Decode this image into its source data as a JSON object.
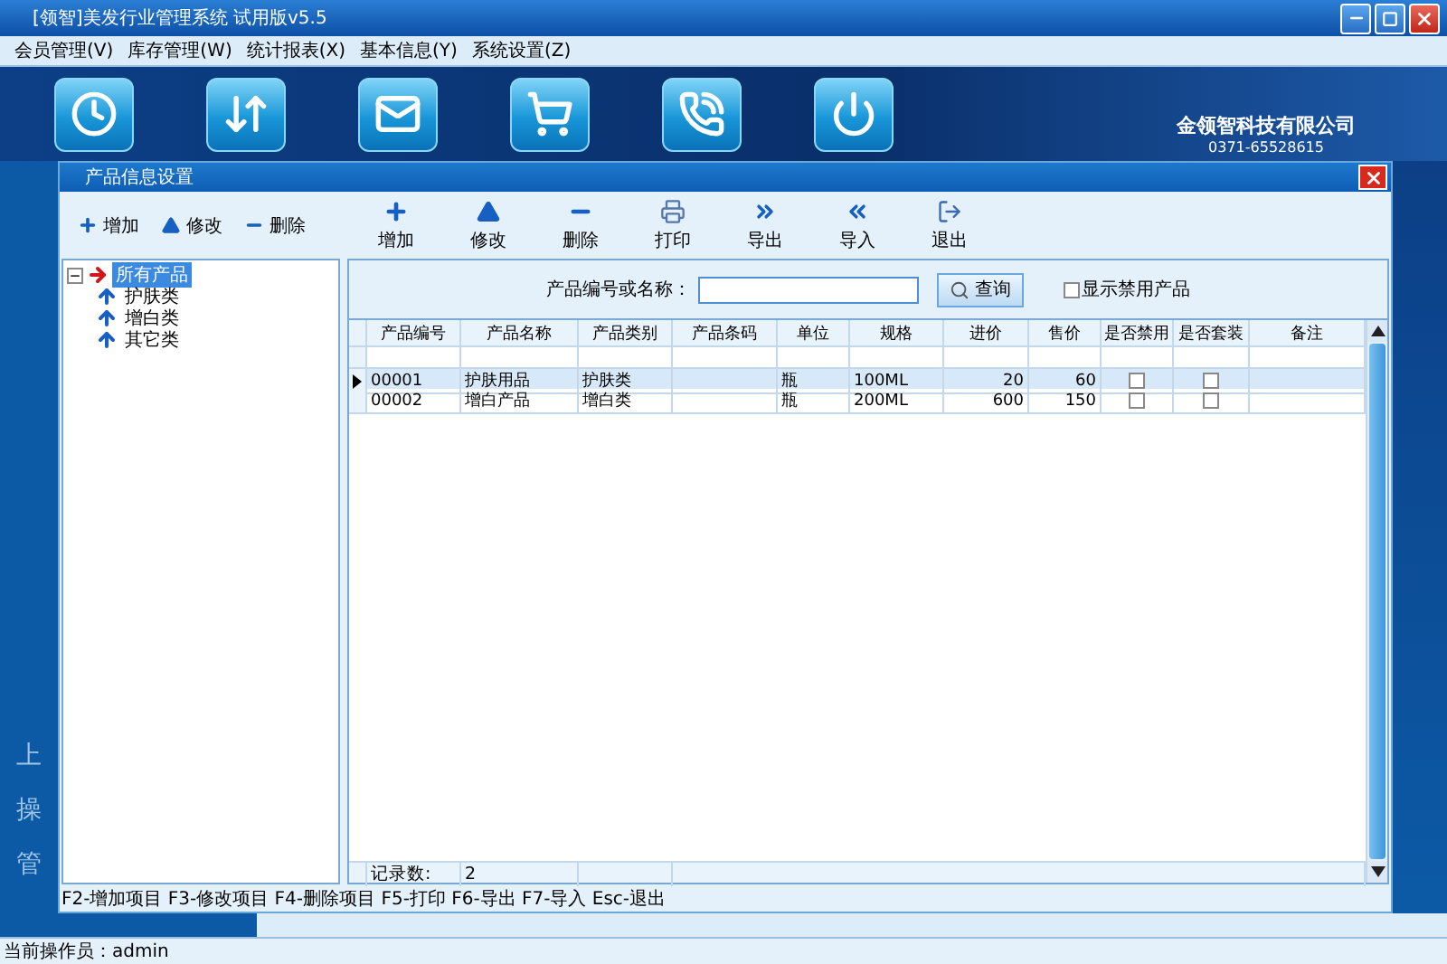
{
  "window": {
    "title": "[领智]美发行业管理系统 试用版v5.5"
  },
  "menu": [
    {
      "label": "会员管理(V)"
    },
    {
      "label": "库存管理(W)"
    },
    {
      "label": "统计报表(X)"
    },
    {
      "label": "基本信息(Y)"
    },
    {
      "label": "系统设置(Z)"
    }
  ],
  "banner": {
    "tools": [
      {
        "kind": "clock"
      },
      {
        "kind": "arrows"
      },
      {
        "kind": "mail"
      },
      {
        "kind": "cart"
      },
      {
        "kind": "phone"
      },
      {
        "kind": "power"
      }
    ],
    "company": "金领智科技有限公司",
    "phone": "0371-65528615"
  },
  "side_text": [
    "上",
    "操",
    "管"
  ],
  "dialog": {
    "title": "产品信息设置",
    "tree_toolbar": [
      {
        "kind": "add",
        "label": "增加"
      },
      {
        "kind": "edit",
        "label": "修改"
      },
      {
        "kind": "delete",
        "label": "删除"
      }
    ],
    "toolbar": [
      {
        "kind": "add",
        "label": "增加"
      },
      {
        "kind": "edit",
        "label": "修改"
      },
      {
        "kind": "delete",
        "label": "删除"
      },
      {
        "kind": "print",
        "label": "打印"
      },
      {
        "kind": "export",
        "label": "导出"
      },
      {
        "kind": "import",
        "label": "导入"
      },
      {
        "kind": "exit",
        "label": "退出"
      }
    ],
    "tree": {
      "label": "所有产品",
      "expanded": true,
      "selected": true,
      "children": [
        {
          "label": "护肤类",
          "selected": false
        },
        {
          "label": "增白类",
          "selected": false
        },
        {
          "label": "其它类",
          "selected": false
        }
      ]
    },
    "search": {
      "label": "产品编号或名称：",
      "button": "查询",
      "show_disabled": {
        "label": "显示禁用产品",
        "checked": false
      }
    },
    "table": {
      "columns": [
        {
          "label": "产品编号",
          "kind": "text"
        },
        {
          "label": "产品名称",
          "kind": "text"
        },
        {
          "label": "产品类别",
          "kind": "text"
        },
        {
          "label": "产品条码",
          "kind": "text"
        },
        {
          "label": "单位",
          "kind": "text"
        },
        {
          "label": "规格",
          "kind": "text"
        },
        {
          "label": "进价",
          "kind": "number"
        },
        {
          "label": "售价",
          "kind": "number"
        },
        {
          "label": "是否禁用",
          "kind": "check"
        },
        {
          "label": "是否套装",
          "kind": "check"
        },
        {
          "label": "备注",
          "kind": "text"
        }
      ],
      "rows": [
        {
          "selected": true,
          "cells": [
            "00001",
            "护肤用品",
            "护肤类",
            "",
            "瓶",
            "100ML",
            "20",
            "60",
            false,
            false,
            ""
          ]
        },
        {
          "selected": false,
          "cells": [
            "00002",
            "增白产品",
            "增白类",
            "",
            "瓶",
            "200ML",
            "600",
            "150",
            false,
            false,
            ""
          ]
        }
      ],
      "record_count": {
        "label": "记录数:",
        "value": "2"
      }
    },
    "shortcuts": "F2-增加项目 F3-修改项目 F4-删除项目 F5-打印 F6-导出 F7-导入 Esc-退出"
  },
  "status_bar": {
    "text": "当前操作员：admin"
  }
}
